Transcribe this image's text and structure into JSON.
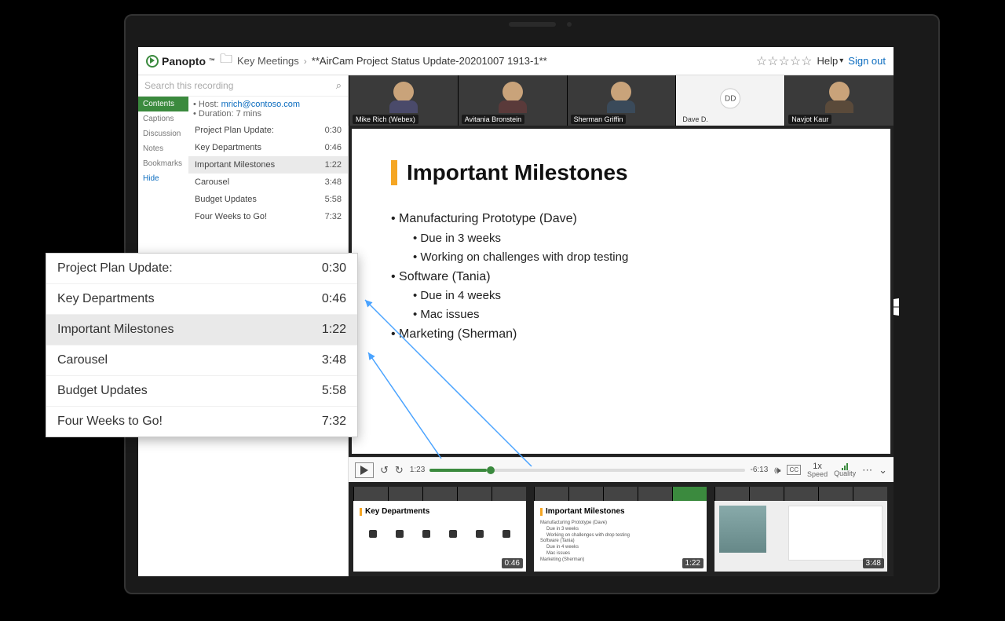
{
  "header": {
    "brand": "Panopto",
    "folder": "Key Meetings",
    "title": "**AirCam Project Status Update-20201007 1913-1**",
    "help": "Help",
    "signout": "Sign out"
  },
  "search": {
    "placeholder": "Search this recording"
  },
  "side_tabs": {
    "contents": "Contents",
    "captions": "Captions",
    "discussion": "Discussion",
    "notes": "Notes",
    "bookmarks": "Bookmarks",
    "hide": "Hide"
  },
  "meta": {
    "host_label": "• Host: ",
    "host_email": "mrich@contoso.com",
    "duration": "• Duration: 7 mins"
  },
  "chapters": [
    {
      "label": "Project Plan Update:",
      "time": "0:30"
    },
    {
      "label": "Key Departments",
      "time": "0:46"
    },
    {
      "label": "Important Milestones",
      "time": "1:22"
    },
    {
      "label": "Carousel",
      "time": "3:48"
    },
    {
      "label": "Budget Updates",
      "time": "5:58"
    },
    {
      "label": "Four Weeks to Go!",
      "time": "7:32"
    }
  ],
  "participants": [
    {
      "name": "Mike Rich (Webex)"
    },
    {
      "name": "Avitania Bronstein"
    },
    {
      "name": "Sherman Griffin"
    },
    {
      "name": "Dave D.",
      "initials": "DD"
    },
    {
      "name": "Navjot Kaur"
    }
  ],
  "slide": {
    "title": "Important Milestones",
    "b1": "Manufacturing Prototype (Dave)",
    "b1a": "Due in 3 weeks",
    "b1b": "Working on challenges with drop testing",
    "b2": "Software (Tania)",
    "b2a": "Due in 4 weeks",
    "b2b": "Mac issues",
    "b3": "Marketing (Sherman)"
  },
  "player": {
    "current": "1:23",
    "remaining": "-6:13",
    "speed_val": "1x",
    "speed_lbl": "Speed",
    "quality_lbl": "Quality",
    "cc": "CC"
  },
  "thumbs": [
    {
      "title": "Key Departments",
      "time": "0:46"
    },
    {
      "title": "Important Milestones",
      "time": "1:22"
    },
    {
      "title": "",
      "time": "3:48"
    }
  ],
  "thumb1_sub": {
    "a": "Manufacturing Prototype (Dave)",
    "aa": "Due in 3 weeks",
    "ab": "Working on challenges with drop testing",
    "b": "Software (Tania)",
    "ba": "Due in 4 weeks",
    "bb": "Mac issues",
    "c": "Marketing (Sherman)"
  }
}
